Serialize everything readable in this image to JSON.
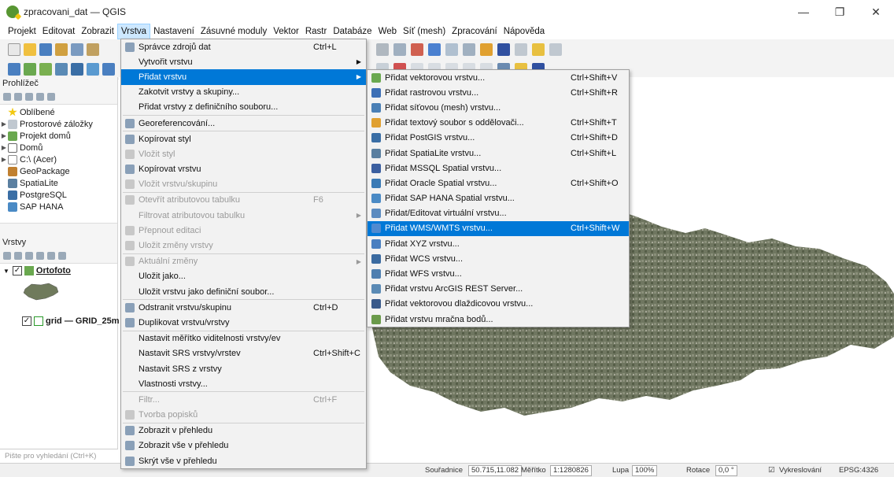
{
  "window": {
    "title": "zpracovani_dat — QGIS",
    "min_glyph": "—",
    "max_glyph": "❐",
    "close_glyph": "✕"
  },
  "menubar": [
    "Projekt",
    "Editovat",
    "Zobrazit",
    "Vrstva",
    "Nastavení",
    "Zásuvné moduly",
    "Vektor",
    "Rastr",
    "Databáze",
    "Web",
    "Síť (mesh)",
    "Zpracování",
    "Nápověda"
  ],
  "browser": {
    "title": "Prohlížeč",
    "items": [
      "Oblíbené",
      "Prostorové záložky",
      "Projekt domů",
      "Domů",
      "C:\\ (Acer)",
      "GeoPackage",
      "SpatiaLite",
      "PostgreSQL",
      "SAP HANA"
    ]
  },
  "layers": {
    "title": "Vrstvy",
    "ortofoto": "Ortofoto",
    "grid": "grid — GRID_25m_"
  },
  "search_placeholder": "Pište pro vyhledání (Ctrl+K)",
  "layer_menu": {
    "items": [
      {
        "label": "Správce zdrojů dat",
        "shortcut": "Ctrl+L",
        "icon": "data-source-manager-icon"
      },
      {
        "label": "Vytvořit vrstvu",
        "submenu": true
      },
      {
        "label": "Přidat vrstvu",
        "submenu": true,
        "highlighted": true
      },
      {
        "label": "Zakotvit vrstvy a skupiny..."
      },
      {
        "label": "Přidat vrstvy z definičního souboru..."
      },
      {
        "label": "Georeferencování...",
        "icon": "georeferencer-icon"
      },
      {
        "label": "Kopírovat styl",
        "icon": "copy-style-icon"
      },
      {
        "label": "Vložit styl",
        "disabled": true,
        "icon": "paste-style-icon"
      },
      {
        "label": "Kopírovat vrstvu",
        "icon": "copy-layer-icon"
      },
      {
        "label": "Vložit vrstvu/skupinu",
        "disabled": true,
        "icon": "paste-layer-icon"
      },
      {
        "label": "Otevřít atributovou tabulku",
        "shortcut": "F6",
        "disabled": true,
        "icon": "attribute-table-icon"
      },
      {
        "label": "Filtrovat atributovou tabulku",
        "disabled": true,
        "submenu": true
      },
      {
        "label": "Přepnout editaci",
        "disabled": true,
        "icon": "toggle-editing-icon"
      },
      {
        "label": "Uložit změny vrstvy",
        "disabled": true,
        "icon": "save-edits-icon"
      },
      {
        "label": "Aktuální změny",
        "disabled": true,
        "submenu": true,
        "icon": "current-edits-icon"
      },
      {
        "label": "Uložit jako..."
      },
      {
        "label": "Uložit vrstvu jako definiční soubor..."
      },
      {
        "label": "Odstranit vrstvu/skupinu",
        "shortcut": "Ctrl+D",
        "icon": "remove-layer-icon"
      },
      {
        "label": "Duplikovat vrstvu/vrstvy",
        "icon": "duplicate-layer-icon"
      },
      {
        "label": "Nastavit měřítko viditelnosti vrstvy/ev"
      },
      {
        "label": "Nastavit SRS vrstvy/vrstev",
        "shortcut": "Ctrl+Shift+C"
      },
      {
        "label": "Nastavit SRS z vrstvy"
      },
      {
        "label": "Vlastnosti vrstvy..."
      },
      {
        "label": "Filtr...",
        "shortcut": "Ctrl+F",
        "disabled": true
      },
      {
        "label": "Tvorba popisků",
        "disabled": true,
        "icon": "labeling-icon"
      },
      {
        "label": "Zobrazit v přehledu",
        "icon": "overview-icon"
      },
      {
        "label": "Zobrazit vše v přehledu",
        "icon": "overview-all-icon"
      },
      {
        "label": "Skrýt vše v přehledu",
        "icon": "overview-hide-icon"
      }
    ]
  },
  "add_layer_menu": {
    "items": [
      {
        "label": "Přidat vektorovou vrstvu...",
        "shortcut": "Ctrl+Shift+V",
        "icon": "vector-layer-icon",
        "color": "#6aa84f"
      },
      {
        "label": "Přidat rastrovou vrstvu...",
        "shortcut": "Ctrl+Shift+R",
        "icon": "raster-layer-icon",
        "color": "#3d6fb5"
      },
      {
        "label": "Přidat síťovou (mesh) vrstvu...",
        "icon": "mesh-layer-icon",
        "color": "#4a7fb5"
      },
      {
        "label": "Přidat textový soubor s oddělovači...",
        "shortcut": "Ctrl+Shift+T",
        "icon": "delimited-text-icon",
        "color": "#e0a030"
      },
      {
        "label": "Přidat PostGIS vrstvu...",
        "shortcut": "Ctrl+Shift+D",
        "icon": "postgis-icon",
        "color": "#3a6ea5"
      },
      {
        "label": "Přidat SpatiaLite vrstvu...",
        "shortcut": "Ctrl+Shift+L",
        "icon": "spatialite-icon",
        "color": "#5a7fa0"
      },
      {
        "label": "Přidat MSSQL Spatial vrstvu...",
        "icon": "mssql-icon",
        "color": "#3b5fa0"
      },
      {
        "label": "Přidat Oracle Spatial vrstvu...",
        "shortcut": "Ctrl+Shift+O",
        "icon": "oracle-icon",
        "color": "#3a7ab5"
      },
      {
        "label": "Přidat SAP HANA Spatial vrstvu...",
        "icon": "sap-hana-icon",
        "color": "#4a8ac5"
      },
      {
        "label": "Přidat/Editovat virtuální vrstvu...",
        "icon": "virtual-layer-icon",
        "color": "#5b8bc0"
      },
      {
        "label": "Přidat WMS/WMTS vrstvu...",
        "shortcut": "Ctrl+Shift+W",
        "icon": "wms-icon",
        "highlighted": true,
        "color": "#4f8ad0"
      },
      {
        "label": "Přidat XYZ vrstvu...",
        "icon": "xyz-icon",
        "color": "#4a7fc0"
      },
      {
        "label": "Přidat WCS vrstvu...",
        "icon": "wcs-icon",
        "color": "#3a6aa0"
      },
      {
        "label": "Přidat WFS vrstvu...",
        "icon": "wfs-icon",
        "color": "#4f7fb0"
      },
      {
        "label": "Přidat vrstvu ArcGIS REST Server...",
        "icon": "arcgis-rest-icon",
        "color": "#5a8ab5"
      },
      {
        "label": "Přidat vektorovou dlaždicovou vrstvu...",
        "icon": "vector-tile-icon",
        "color": "#3a5a8a"
      },
      {
        "label": "Přidat vrstvu mračna bodů...",
        "icon": "point-cloud-icon",
        "color": "#6a9a4a"
      }
    ]
  },
  "statusbar": {
    "coord_label": "Souřadnice",
    "coord_value": "50.715,11.082",
    "scale_label": "Měřítko",
    "scale_value": "1:1280826",
    "magnifier_label": "Lupa",
    "magnifier_value": "100%",
    "rotation_label": "Rotace",
    "rotation_value": "0,0 °",
    "render_label": "Vykreslování",
    "crs": "EPSG:4326"
  },
  "colors": {
    "menu_highlight": "#0078d7",
    "menubar_active": "#cde8ff"
  }
}
